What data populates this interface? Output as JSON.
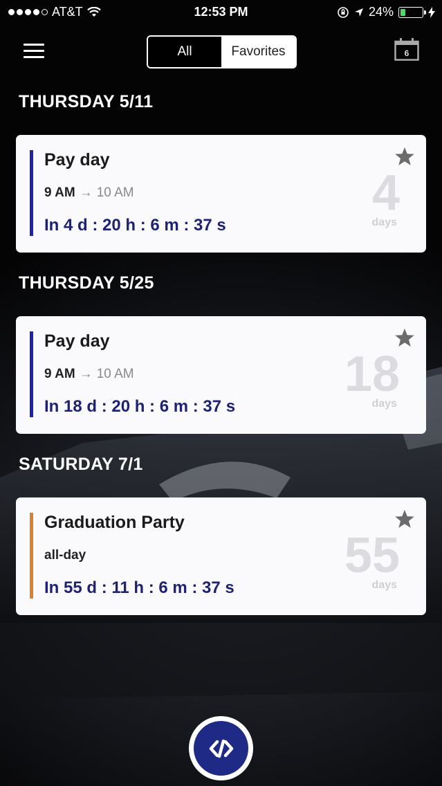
{
  "status_bar": {
    "carrier": "AT&T",
    "time": "12:53 PM",
    "battery_percent": "24%",
    "battery_level": 0.24,
    "signal_bars": 4,
    "icons": [
      "wifi-icon",
      "orientation-lock-icon",
      "location-arrow-icon",
      "battery-icon",
      "charging-bolt-icon"
    ]
  },
  "nav": {
    "menu_icon": "hamburger-menu-icon",
    "tabs": [
      {
        "label": "All",
        "selected": true
      },
      {
        "label": "Favorites",
        "selected": false
      }
    ],
    "calendar_icon": "calendar-icon",
    "calendar_day": "6"
  },
  "sections": [
    {
      "date": "THURSDAY 5/11",
      "event": {
        "title": "Pay day",
        "start": "9 AM",
        "end": "10 AM",
        "countdown": "In 4 d : 20 h : 6 m : 37 s",
        "days": "4",
        "days_label": "days",
        "color": "#1f22a8",
        "favorite": true
      }
    },
    {
      "date": "THURSDAY 5/25",
      "event": {
        "title": "Pay day",
        "start": "9 AM",
        "end": "10 AM",
        "countdown": "In 18 d : 20 h : 6 m : 37 s",
        "days": "18",
        "days_label": "days",
        "color": "#1f22a8",
        "favorite": true
      }
    },
    {
      "date": "SATURDAY 7/1",
      "event": {
        "title": "Graduation Party",
        "all_day": "all-day",
        "countdown": "In 55 d : 11 h : 6 m : 37 s",
        "days": "55",
        "days_label": "days",
        "color": "#d9822b",
        "favorite": true
      }
    }
  ],
  "colors": {
    "accent": "#1f2a86",
    "countdown_text": "#1e2270",
    "star": "#6b6b6b"
  },
  "fab": {
    "icon": "code-link-icon"
  }
}
